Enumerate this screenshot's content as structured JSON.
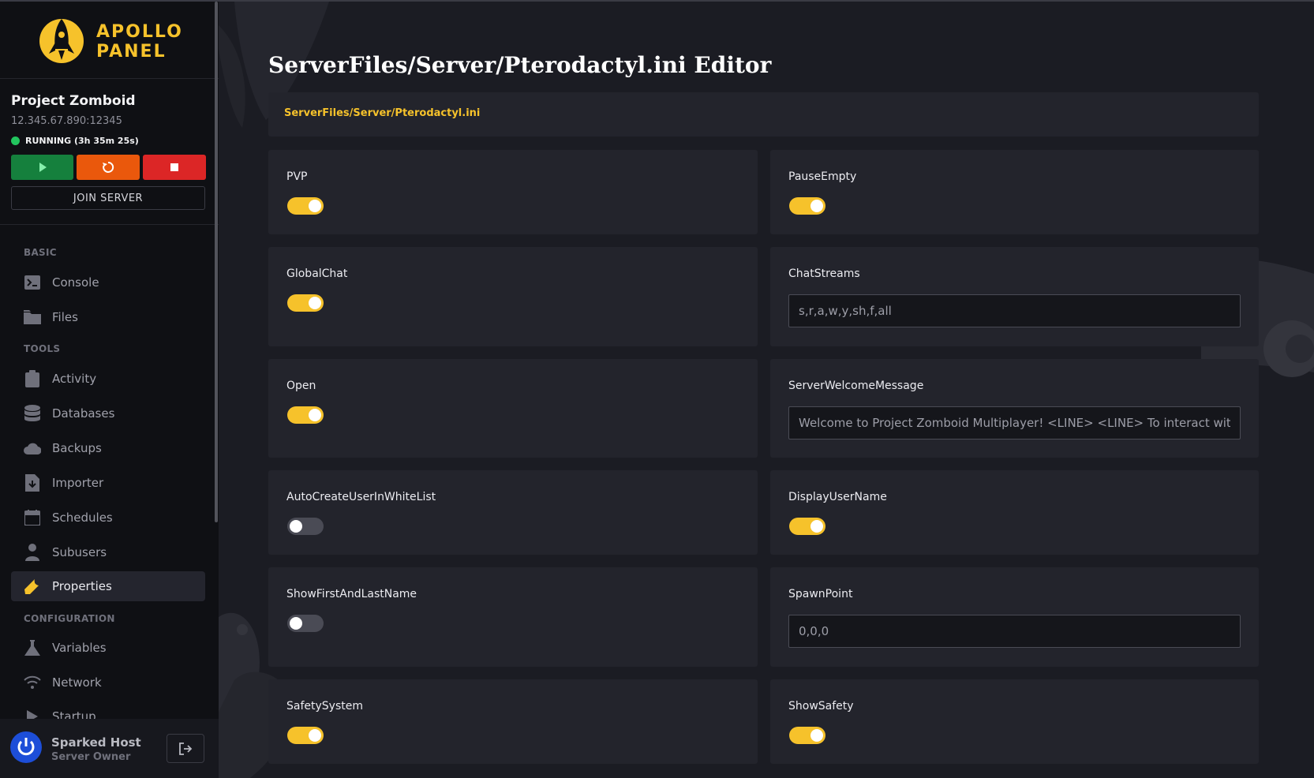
{
  "brand": {
    "line1": "APOLLO",
    "line2": "PANEL"
  },
  "server": {
    "name": "Project Zomboid",
    "address": "12.345.67.890:12345",
    "status": "RUNNING (3h 35m 25s)",
    "join_label": "JOIN SERVER"
  },
  "nav": {
    "basic_title": "BASIC",
    "tools_title": "TOOLS",
    "config_title": "CONFIGURATION",
    "console": "Console",
    "files": "Files",
    "activity": "Activity",
    "databases": "Databases",
    "backups": "Backups",
    "importer": "Importer",
    "schedules": "Schedules",
    "subusers": "Subusers",
    "properties": "Properties",
    "variables": "Variables",
    "network": "Network",
    "startup": "Startup"
  },
  "user": {
    "name": "Sparked Host",
    "role": "Server Owner"
  },
  "page": {
    "title": "ServerFiles/Server/Pterodactyl.ini Editor",
    "path": "ServerFiles/Server/Pterodactyl.ini"
  },
  "settings": {
    "pvp": {
      "label": "PVP",
      "enabled": true
    },
    "pause_empty": {
      "label": "PauseEmpty",
      "enabled": true
    },
    "global_chat": {
      "label": "GlobalChat",
      "enabled": true
    },
    "chat_streams": {
      "label": "ChatStreams",
      "value": "s,r,a,w,y,sh,f,all"
    },
    "open": {
      "label": "Open",
      "enabled": true
    },
    "welcome_message": {
      "label": "ServerWelcomeMessage",
      "value": "Welcome to Project Zomboid Multiplayer! <LINE> <LINE> To interact with th"
    },
    "auto_create_whitelist": {
      "label": "AutoCreateUserInWhiteList",
      "enabled": false
    },
    "display_user_name": {
      "label": "DisplayUserName",
      "enabled": true
    },
    "show_first_last_name": {
      "label": "ShowFirstAndLastName",
      "enabled": false
    },
    "spawn_point": {
      "label": "SpawnPoint",
      "value": "0,0,0"
    },
    "safety_system": {
      "label": "SafetySystem",
      "enabled": true
    },
    "show_safety": {
      "label": "ShowSafety",
      "enabled": true
    }
  },
  "colors": {
    "accent": "#f6c22b",
    "background": "#1b1c23",
    "card": "#23242c",
    "sidebar": "#0f1014",
    "running": "#22c55e"
  }
}
